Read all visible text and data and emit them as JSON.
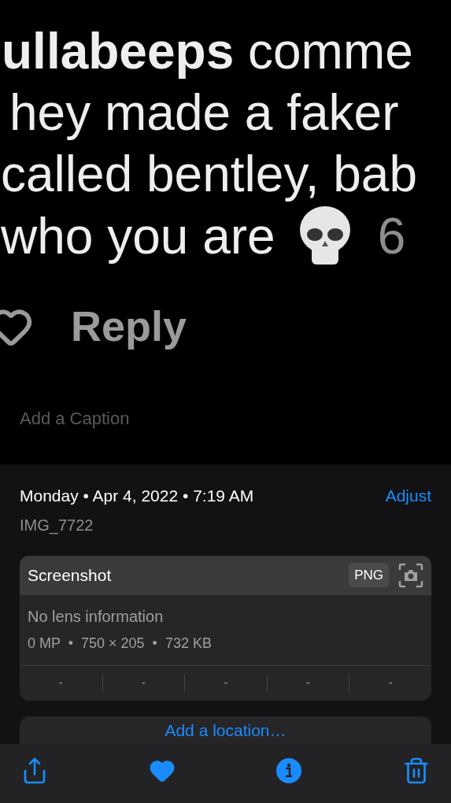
{
  "photo": {
    "lines": [
      "**ullabeeps** comme",
      "hey made a faker",
      "called bentley, bab",
      "who you are"
    ],
    "time": "6",
    "reply": "Reply"
  },
  "caption": {
    "placeholder": "Add a Caption"
  },
  "info": {
    "date": "Monday • Apr 4, 2022 • 7:19 AM",
    "adjust": "Adjust",
    "filename": "IMG_7722",
    "card": {
      "title": "Screenshot",
      "format": "PNG",
      "lens": "No lens information",
      "specs": "0 MP  •  750 × 205  •  732 KB",
      "exif": [
        "-",
        "-",
        "-",
        "-",
        "-"
      ]
    },
    "location": "Add a location…"
  },
  "toolbar": [
    {
      "kind": "share"
    },
    {
      "kind": "favorite",
      "selected": true
    },
    {
      "kind": "info",
      "selected": true
    },
    {
      "kind": "delete"
    }
  ]
}
